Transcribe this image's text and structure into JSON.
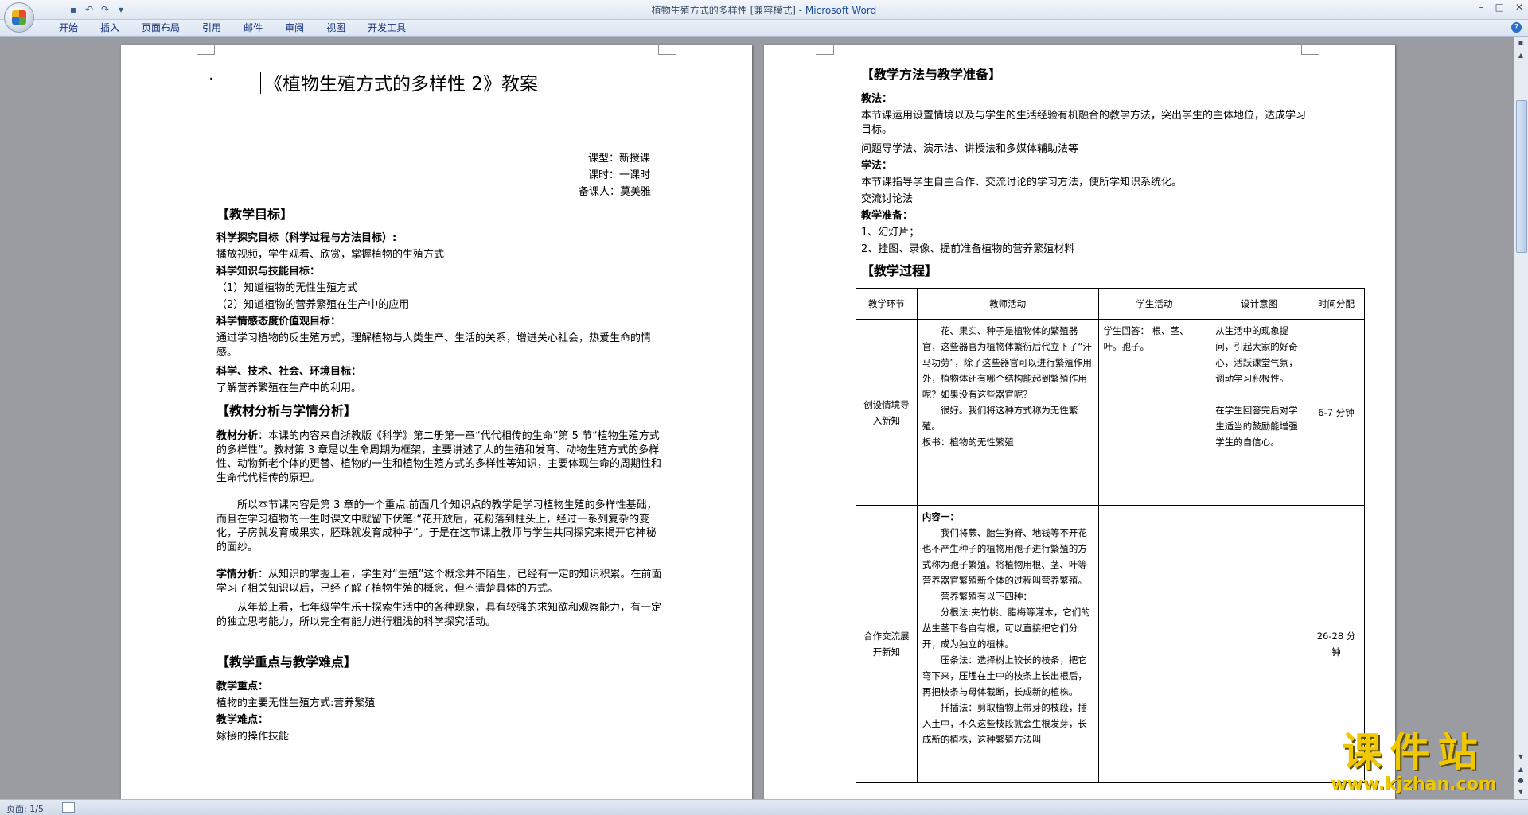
{
  "window": {
    "title_doc": "植物生殖方式的多样性 [兼容模式] - ",
    "title_app": "Microsoft Word",
    "qat_icons": [
      "save-icon",
      "undo-icon",
      "redo-icon",
      "customize-icon"
    ]
  },
  "ribbon": {
    "tabs": [
      "开始",
      "插入",
      "页面布局",
      "引用",
      "邮件",
      "审阅",
      "视图",
      "开发工具"
    ]
  },
  "page1": {
    "title": "《植物生殖方式的多样性 2》教案",
    "meta": [
      "课型：新授课",
      "课时：一课时",
      "备课人：莫美雅"
    ],
    "sec_goals": "【教学目标】",
    "goal1_h": "科学探究目标（科学过程与方法目标）:",
    "goal1_t": "播放视频，学生观看、欣赏，掌握植物的生殖方式",
    "goal2_h": "科学知识与技能目标：",
    "goal2_t1": "（1）知道植物的无性生殖方式",
    "goal2_t2": "（2）知道植物的营养繁殖在生产中的应用",
    "goal3_h": "科学情感态度价值观目标：",
    "goal3_t": "通过学习植物的反生殖方式，理解植物与人类生产、生活的关系，增进关心社会，热爱生命的情感。",
    "goal4_h": "科学、技术、社会、环境目标：",
    "goal4_t": "了解营养繁殖在生产中的利用。",
    "sec_analysis": "【教材分析与学情分析】",
    "ana1_h": "教材分析",
    "ana1_t": "：本课的内容来自浙教版《科学》第二册第一章“代代相传的生命”第 5 节“植物生殖方式的多样性”。教材第 3 章是以生命周期为框架，主要讲述了人的生殖和发育、动物生殖方式的多样性、动物新老个体的更替、植物的一生和植物生殖方式的多样性等知识，主要体现生命的周期性和生命代代相传的原理。",
    "ana1_t2": "所以本节课内容是第 3 章的一个重点.前面几个知识点的教学是学习植物生殖的多样性基础，而且在学习植物的一生时课文中就留下伏笔:“花开放后，花粉落到柱头上，经过一系列复杂的变化，子房就发育成果实，胚珠就发育成种子”。于是在这节课上教师与学生共同探究来揭开它神秘的面纱。",
    "ana2_h": "学情分析",
    "ana2_t": "：从知识的掌握上看，学生对“生殖”这个概念并不陌生，已经有一定的知识积累。在前面学习了相关知识以后，已经了解了植物生殖的概念，但不清楚具体的方式。",
    "ana2_t2": "从年龄上看，七年级学生乐于探索生活中的各种现象，具有较强的求知欲和观察能力，有一定的独立思考能力，所以完全有能力进行粗浅的科学探究活动。",
    "sec_key": "【教学重点与教学难点】",
    "key_h": "教学重点：",
    "key_t": "植物的主要无性生殖方式:营养繁殖",
    "diff_h": "教学难点：",
    "diff_t": "嫁接的操作技能"
  },
  "page2": {
    "sec_method": "【教学方法与教学准备】",
    "teach_h": "教法：",
    "teach_t1": "本节课运用设置情境以及与学生的生活经验有机融合的教学方法，突出学生的主体地位，达成学习目标。",
    "teach_t2": "问题导学法、演示法、讲授法和多媒体辅助法等",
    "learn_h": "学法：",
    "learn_t1": "本节课指导学生自主合作、交流讨论的学习方法，使所学知识系统化。",
    "learn_t2": "交流讨论法",
    "prep_h": "教学准备：",
    "prep_1": "1、幻灯片；",
    "prep_2": "2、挂图、录像、提前准备植物的营养繁殖材料",
    "sec_process": "【教学过程】",
    "table": {
      "headers": [
        "教学环节",
        "教师活动",
        "学生活动",
        "设计意图",
        "时间分配"
      ],
      "row1": {
        "stage": "创设情境导入新知",
        "teacher": [
          "花、果实、种子是植物体的繁殖器官，这些器官为植物体繁衍后代立下了“汗马功劳”，除了这些器官可以进行繁殖作用外，植物体还有哪个结构能起到繁殖作用呢？如果没有这些器官呢？",
          "很好。我们将这种方式称为无性繁殖。",
          "板书：植物的无性繁殖"
        ],
        "student": "学生回答： 根、茎、叶。孢子。",
        "intent": [
          "从生活中的现象提问，引起大家的好奇心，活跃课堂气氛，调动学习积极性。",
          "在学生回答完后对学生适当的鼓励能增强学生的自信心。"
        ],
        "time": "6-7 分钟"
      },
      "row2": {
        "stage": "合作交流展开新知",
        "teacher": [
          "内容一：",
          "我们将蕨、胎生狗脊、地钱等不开花也不产生种子的植物用孢子进行繁殖的方式称为孢子繁殖。将植物用根、茎、叶等营养器官繁殖新个体的过程叫营养繁殖。",
          "营养繁殖有以下四种：",
          "分根法:夹竹桃、腊梅等灌木，它们的丛生茎下各自有根，可以直接把它们分开，成为独立的植株。",
          "压条法：选择树上较长的枝条，把它弯下来，压埋在土中的枝条上长出根后，再把枝条与母体截断，长成新的植株。",
          "扦插法：剪取植物上带芽的枝段，插入土中，不久这些枝段就会生根发芽，长成新的植株，这种繁殖方法叫"
        ],
        "time": "26-28 分钟"
      }
    }
  },
  "status": {
    "page": "页面: 1/5"
  },
  "watermark": {
    "text": "课件站",
    "url": "www.kjzhan.com"
  }
}
